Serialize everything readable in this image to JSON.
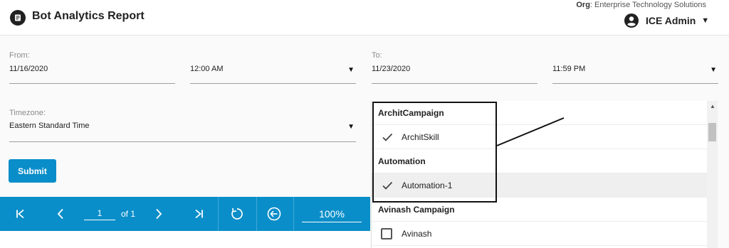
{
  "header": {
    "title": "Bot Analytics Report",
    "org_label": "Org",
    "org_name": "Enterprise Technology Solutions",
    "user_name": "ICE Admin"
  },
  "filters": {
    "from_label": "From:",
    "from_date": "11/16/2020",
    "from_time": "12:00 AM",
    "to_label": "To:",
    "to_date": "11/23/2020",
    "to_time": "11:59 PM",
    "timezone_label": "Timezone:",
    "timezone_value": "Eastern Standard Time",
    "submit_label": "Submit"
  },
  "pager": {
    "page": "1",
    "of_text": "of 1",
    "zoom": "100%"
  },
  "skill_list": {
    "rows": [
      {
        "type": "group",
        "label": "ArchitCampaign"
      },
      {
        "type": "item",
        "label": "ArchitSkill",
        "checked": true
      },
      {
        "type": "group",
        "label": "Automation"
      },
      {
        "type": "item",
        "label": "Automation-1",
        "checked": true
      },
      {
        "type": "group",
        "label": "Avinash Campaign"
      },
      {
        "type": "item",
        "label": "Avinash",
        "checked": false
      }
    ]
  },
  "colors": {
    "accent": "#0a8ec9",
    "header_bg": "#ffffff",
    "page_bg": "#fafafa"
  }
}
